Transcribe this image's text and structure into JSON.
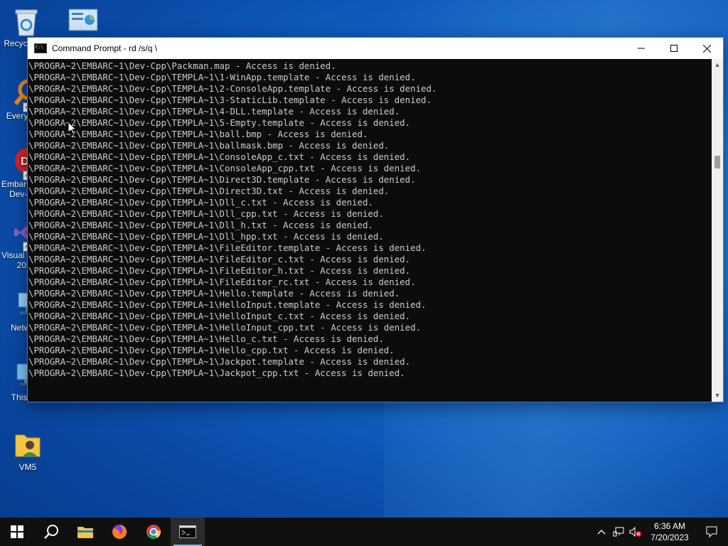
{
  "desktop": {
    "icons": [
      {
        "label": "Recycle Bin",
        "icon": "recycle-bin-icon"
      },
      {
        "label": "",
        "icon": "control-panel-icon"
      },
      {
        "label": "Everything",
        "icon": "everything-search-icon"
      },
      {
        "label": "Embarcadero Dev-C++",
        "icon": "devcpp-icon"
      },
      {
        "label": "Visual Studio 2022",
        "icon": "visual-studio-icon"
      },
      {
        "label": "Network",
        "icon": "network-icon"
      },
      {
        "label": "This PC",
        "icon": "this-pc-icon"
      },
      {
        "label": "VM5",
        "icon": "user-folder-icon"
      }
    ]
  },
  "window": {
    "title": "Command Prompt - rd /s/q \\",
    "minimize": "—",
    "maximize": "☐",
    "close": "✕",
    "console_lines": [
      "\\PROGRA~2\\EMBARC~1\\Dev-Cpp\\Packman.map - Access is denied.",
      "\\PROGRA~2\\EMBARC~1\\Dev-Cpp\\TEMPLA~1\\1-WinApp.template - Access is denied.",
      "\\PROGRA~2\\EMBARC~1\\Dev-Cpp\\TEMPLA~1\\2-ConsoleApp.template - Access is denied.",
      "\\PROGRA~2\\EMBARC~1\\Dev-Cpp\\TEMPLA~1\\3-StaticLib.template - Access is denied.",
      "\\PROGRA~2\\EMBARC~1\\Dev-Cpp\\TEMPLA~1\\4-DLL.template - Access is denied.",
      "\\PROGRA~2\\EMBARC~1\\Dev-Cpp\\TEMPLA~1\\5-Empty.template - Access is denied.",
      "\\PROGRA~2\\EMBARC~1\\Dev-Cpp\\TEMPLA~1\\ball.bmp - Access is denied.",
      "\\PROGRA~2\\EMBARC~1\\Dev-Cpp\\TEMPLA~1\\ballmask.bmp - Access is denied.",
      "\\PROGRA~2\\EMBARC~1\\Dev-Cpp\\TEMPLA~1\\ConsoleApp_c.txt - Access is denied.",
      "\\PROGRA~2\\EMBARC~1\\Dev-Cpp\\TEMPLA~1\\ConsoleApp_cpp.txt - Access is denied.",
      "\\PROGRA~2\\EMBARC~1\\Dev-Cpp\\TEMPLA~1\\Direct3D.template - Access is denied.",
      "\\PROGRA~2\\EMBARC~1\\Dev-Cpp\\TEMPLA~1\\Direct3D.txt - Access is denied.",
      "\\PROGRA~2\\EMBARC~1\\Dev-Cpp\\TEMPLA~1\\Dll_c.txt - Access is denied.",
      "\\PROGRA~2\\EMBARC~1\\Dev-Cpp\\TEMPLA~1\\Dll_cpp.txt - Access is denied.",
      "\\PROGRA~2\\EMBARC~1\\Dev-Cpp\\TEMPLA~1\\Dll_h.txt - Access is denied.",
      "\\PROGRA~2\\EMBARC~1\\Dev-Cpp\\TEMPLA~1\\Dll_hpp.txt - Access is denied.",
      "\\PROGRA~2\\EMBARC~1\\Dev-Cpp\\TEMPLA~1\\FileEditor.template - Access is denied.",
      "\\PROGRA~2\\EMBARC~1\\Dev-Cpp\\TEMPLA~1\\FileEditor_c.txt - Access is denied.",
      "\\PROGRA~2\\EMBARC~1\\Dev-Cpp\\TEMPLA~1\\FileEditor_h.txt - Access is denied.",
      "\\PROGRA~2\\EMBARC~1\\Dev-Cpp\\TEMPLA~1\\FileEditor_rc.txt - Access is denied.",
      "\\PROGRA~2\\EMBARC~1\\Dev-Cpp\\TEMPLA~1\\Hello.template - Access is denied.",
      "\\PROGRA~2\\EMBARC~1\\Dev-Cpp\\TEMPLA~1\\HelloInput.template - Access is denied.",
      "\\PROGRA~2\\EMBARC~1\\Dev-Cpp\\TEMPLA~1\\HelloInput_c.txt - Access is denied.",
      "\\PROGRA~2\\EMBARC~1\\Dev-Cpp\\TEMPLA~1\\HelloInput_cpp.txt - Access is denied.",
      "\\PROGRA~2\\EMBARC~1\\Dev-Cpp\\TEMPLA~1\\Hello_c.txt - Access is denied.",
      "\\PROGRA~2\\EMBARC~1\\Dev-Cpp\\TEMPLA~1\\Hello_cpp.txt - Access is denied.",
      "\\PROGRA~2\\EMBARC~1\\Dev-Cpp\\TEMPLA~1\\Jackpot.template - Access is denied.",
      "\\PROGRA~2\\EMBARC~1\\Dev-Cpp\\TEMPLA~1\\Jackpot_cpp.txt - Access is denied."
    ],
    "scrollbar": {
      "up": "▲",
      "down": "▼"
    }
  },
  "taskbar": {
    "apps": [
      {
        "name": "start-button",
        "icon": "windows-logo-icon"
      },
      {
        "name": "search-button",
        "icon": "search-icon"
      },
      {
        "name": "file-explorer",
        "icon": "folder-icon"
      },
      {
        "name": "firefox",
        "icon": "firefox-icon"
      },
      {
        "name": "chrome",
        "icon": "chrome-icon"
      },
      {
        "name": "command-prompt",
        "icon": "cmd-icon",
        "active": true
      }
    ],
    "tray": {
      "time": "6:36 AM",
      "date": "7/20/2023"
    }
  },
  "colors": {
    "accent": "#76b9ed",
    "console_bg": "#0c0c0c",
    "console_fg": "#cccccc"
  }
}
